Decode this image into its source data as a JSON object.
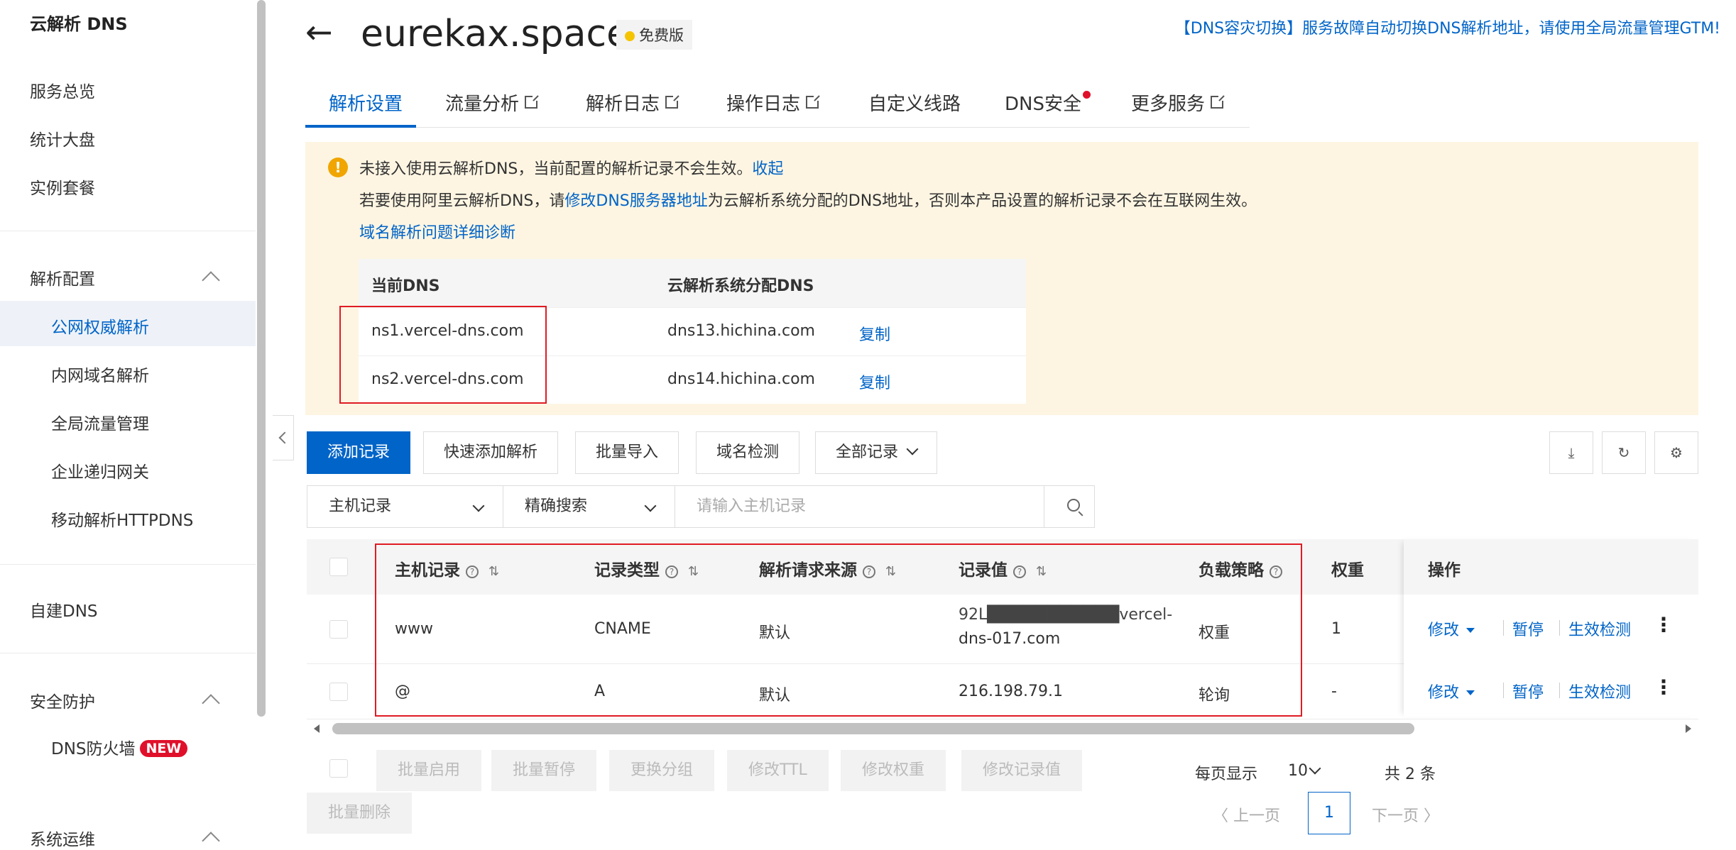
{
  "sidebar": {
    "title": "云解析 DNS",
    "items": [
      "服务总览",
      "统计大盘",
      "实例套餐"
    ],
    "group_config": "解析配置",
    "config_items": [
      "公网权威解析",
      "内网域名解析",
      "全局流量管理",
      "企业递归网关",
      "移动解析HTTPDNS"
    ],
    "self_dns": "自建DNS",
    "group_security": "安全防护",
    "firewall": "DNS防火墙",
    "new_badge": "NEW",
    "group_ops": "系统运维"
  },
  "header": {
    "back": "←",
    "domain": "eurekax.space",
    "plan": "免费版",
    "promo": "【DNS容灾切换】服务故障自动切换DNS解析地址，请使用全局流量管理GTM!"
  },
  "tabs": [
    "解析设置",
    "流量分析",
    "解析日志",
    "操作日志",
    "自定义线路",
    "DNS安全",
    "更多服务"
  ],
  "notice": {
    "line1": "未接入使用云解析DNS，当前配置的解析记录不会生效。",
    "collapse": "收起",
    "line2_pre": "若要使用阿里云解析DNS，请",
    "line2_link": "修改DNS服务器地址",
    "line2_post": "为云解析系统分配的DNS地址，否则本产品设置的解析记录不会在互联网生效。",
    "diagnose": "域名解析问题详细诊断",
    "dns_head_current": "当前DNS",
    "dns_head_assigned": "云解析系统分配DNS",
    "copy": "复制",
    "rows": [
      {
        "current": "ns1.vercel-dns.com",
        "assigned": "dns13.hichina.com"
      },
      {
        "current": "ns2.vercel-dns.com",
        "assigned": "dns14.hichina.com"
      }
    ]
  },
  "toolbar": {
    "add": "添加记录",
    "quick_add": "快速添加解析",
    "import": "批量导入",
    "check": "域名检测",
    "all_records": "全部记录"
  },
  "search": {
    "field": "主机记录",
    "mode": "精确搜索",
    "placeholder": "请输入主机记录"
  },
  "table": {
    "headers": {
      "host": "主机记录",
      "type": "记录类型",
      "source": "解析请求来源",
      "value": "记录值",
      "policy": "负载策略",
      "weight": "权重",
      "ops": "操作"
    },
    "rows": [
      {
        "host": "www",
        "type": "CNAME",
        "source": "默认",
        "value_line1": "92L███████████vercel-",
        "value_line2": "dns-017.com",
        "policy": "权重",
        "weight": "1"
      },
      {
        "host": "@",
        "type": "A",
        "source": "默认",
        "value_line1": "216.198.79.1",
        "value_line2": "",
        "policy": "轮询",
        "weight": "-"
      }
    ],
    "op_edit": "修改",
    "op_pause": "暂停",
    "op_check": "生效检测",
    "op_more": "⋮"
  },
  "batch": {
    "enable": "批量启用",
    "pause": "批量暂停",
    "group": "更换分组",
    "ttl": "修改TTL",
    "weight": "修改权重",
    "value": "修改记录值",
    "delete": "批量删除"
  },
  "pager": {
    "per_page_label": "每页显示",
    "per_page": "10",
    "total": "共 2 条",
    "prev": "上一页",
    "page": "1",
    "next": "下一页"
  }
}
